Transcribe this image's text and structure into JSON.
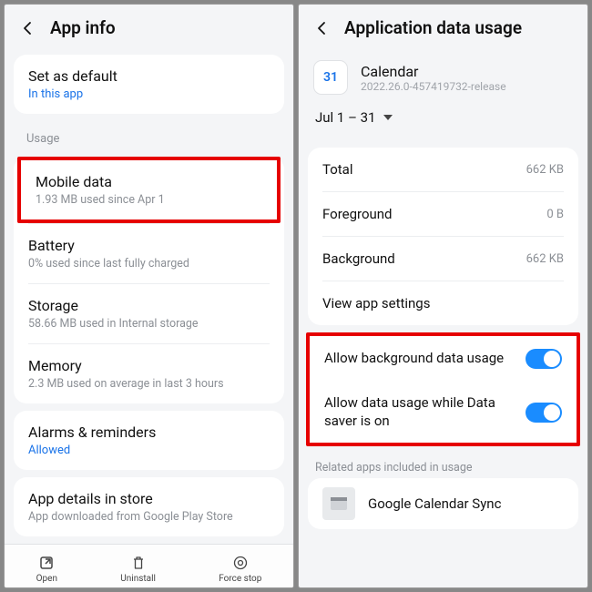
{
  "left": {
    "header_title": "App info",
    "set_as_default": {
      "title": "Set as default",
      "sub": "In this app"
    },
    "usage_label": "Usage",
    "mobile_data": {
      "title": "Mobile data",
      "sub": "1.93 MB used since Apr 1"
    },
    "battery": {
      "title": "Battery",
      "sub": "0% used since last fully charged"
    },
    "storage": {
      "title": "Storage",
      "sub": "58.66 MB used in Internal storage"
    },
    "memory": {
      "title": "Memory",
      "sub": "2.3 MB used on average in last 3 hours"
    },
    "alarms": {
      "title": "Alarms & reminders",
      "sub": "Allowed"
    },
    "app_details": {
      "title": "App details in store",
      "sub": "App downloaded from Google Play Store"
    },
    "bottom": {
      "open": "Open",
      "uninstall": "Uninstall",
      "force_stop": "Force stop"
    }
  },
  "right": {
    "header_title": "Application data usage",
    "app": {
      "name": "Calendar",
      "version": "2022.26.0-457419732-release",
      "icon_num": "31"
    },
    "date_range": "Jul 1 – 31",
    "total": {
      "label": "Total",
      "value": "662 KB"
    },
    "foreground": {
      "label": "Foreground",
      "value": "0 B"
    },
    "background": {
      "label": "Background",
      "value": "662 KB"
    },
    "view_app_settings": "View app settings",
    "allow_bg": "Allow background data usage",
    "allow_ds": "Allow data usage while Data saver is on",
    "related_label": "Related apps included in usage",
    "related_app": "Google Calendar Sync"
  }
}
